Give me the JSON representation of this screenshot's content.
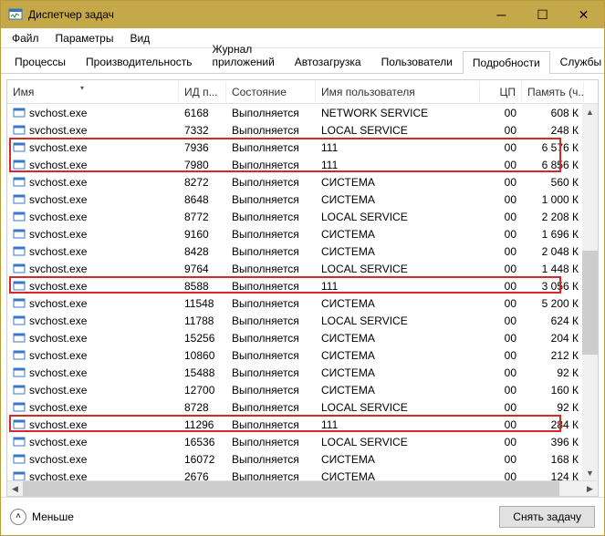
{
  "window": {
    "title": "Диспетчер задач"
  },
  "menu": {
    "file": "Файл",
    "options": "Параметры",
    "view": "Вид"
  },
  "tabs": {
    "processes": "Процессы",
    "performance": "Производительность",
    "app_history": "Журнал приложений",
    "startup": "Автозагрузка",
    "users": "Пользователи",
    "details": "Подробности",
    "services": "Службы"
  },
  "columns": {
    "name": "Имя",
    "pid": "ИД п...",
    "state": "Состояние",
    "user": "Имя пользователя",
    "cpu": "ЦП",
    "mem": "Память (ч..."
  },
  "rows": [
    {
      "name": "svchost.exe",
      "pid": "6168",
      "state": "Выполняется",
      "user": "NETWORK SERVICE",
      "cpu": "00",
      "mem": "608 К"
    },
    {
      "name": "svchost.exe",
      "pid": "7332",
      "state": "Выполняется",
      "user": "LOCAL SERVICE",
      "cpu": "00",
      "mem": "248 К"
    },
    {
      "name": "svchost.exe",
      "pid": "7936",
      "state": "Выполняется",
      "user": "111",
      "cpu": "00",
      "mem": "6 576 К",
      "hl": "group1"
    },
    {
      "name": "svchost.exe",
      "pid": "7980",
      "state": "Выполняется",
      "user": "111",
      "cpu": "00",
      "mem": "6 856 К",
      "hl": "group1"
    },
    {
      "name": "svchost.exe",
      "pid": "8272",
      "state": "Выполняется",
      "user": "СИСТЕМА",
      "cpu": "00",
      "mem": "560 К"
    },
    {
      "name": "svchost.exe",
      "pid": "8648",
      "state": "Выполняется",
      "user": "СИСТЕМА",
      "cpu": "00",
      "mem": "1 000 К"
    },
    {
      "name": "svchost.exe",
      "pid": "8772",
      "state": "Выполняется",
      "user": "LOCAL SERVICE",
      "cpu": "00",
      "mem": "2 208 К"
    },
    {
      "name": "svchost.exe",
      "pid": "9160",
      "state": "Выполняется",
      "user": "СИСТЕМА",
      "cpu": "00",
      "mem": "1 696 К"
    },
    {
      "name": "svchost.exe",
      "pid": "8428",
      "state": "Выполняется",
      "user": "СИСТЕМА",
      "cpu": "00",
      "mem": "2 048 К"
    },
    {
      "name": "svchost.exe",
      "pid": "9764",
      "state": "Выполняется",
      "user": "LOCAL SERVICE",
      "cpu": "00",
      "mem": "1 448 К"
    },
    {
      "name": "svchost.exe",
      "pid": "8588",
      "state": "Выполняется",
      "user": "111",
      "cpu": "00",
      "mem": "3 056 К",
      "hl": "single1"
    },
    {
      "name": "svchost.exe",
      "pid": "11548",
      "state": "Выполняется",
      "user": "СИСТЕМА",
      "cpu": "00",
      "mem": "5 200 К"
    },
    {
      "name": "svchost.exe",
      "pid": "11788",
      "state": "Выполняется",
      "user": "LOCAL SERVICE",
      "cpu": "00",
      "mem": "624 К"
    },
    {
      "name": "svchost.exe",
      "pid": "15256",
      "state": "Выполняется",
      "user": "СИСТЕМА",
      "cpu": "00",
      "mem": "204 К"
    },
    {
      "name": "svchost.exe",
      "pid": "10860",
      "state": "Выполняется",
      "user": "СИСТЕМА",
      "cpu": "00",
      "mem": "212 К"
    },
    {
      "name": "svchost.exe",
      "pid": "15488",
      "state": "Выполняется",
      "user": "СИСТЕМА",
      "cpu": "00",
      "mem": "92 К"
    },
    {
      "name": "svchost.exe",
      "pid": "12700",
      "state": "Выполняется",
      "user": "СИСТЕМА",
      "cpu": "00",
      "mem": "160 К"
    },
    {
      "name": "svchost.exe",
      "pid": "8728",
      "state": "Выполняется",
      "user": "LOCAL SERVICE",
      "cpu": "00",
      "mem": "92 К"
    },
    {
      "name": "svchost.exe",
      "pid": "11296",
      "state": "Выполняется",
      "user": "111",
      "cpu": "00",
      "mem": "284 К",
      "hl": "single2"
    },
    {
      "name": "svchost.exe",
      "pid": "16536",
      "state": "Выполняется",
      "user": "LOCAL SERVICE",
      "cpu": "00",
      "mem": "396 К"
    },
    {
      "name": "svchost.exe",
      "pid": "16072",
      "state": "Выполняется",
      "user": "СИСТЕМА",
      "cpu": "00",
      "mem": "168 К"
    },
    {
      "name": "svchost.exe",
      "pid": "2676",
      "state": "Выполняется",
      "user": "СИСТЕМА",
      "cpu": "00",
      "mem": "124 К"
    }
  ],
  "footer": {
    "less": "Меньше",
    "end_task": "Снять задачу"
  }
}
